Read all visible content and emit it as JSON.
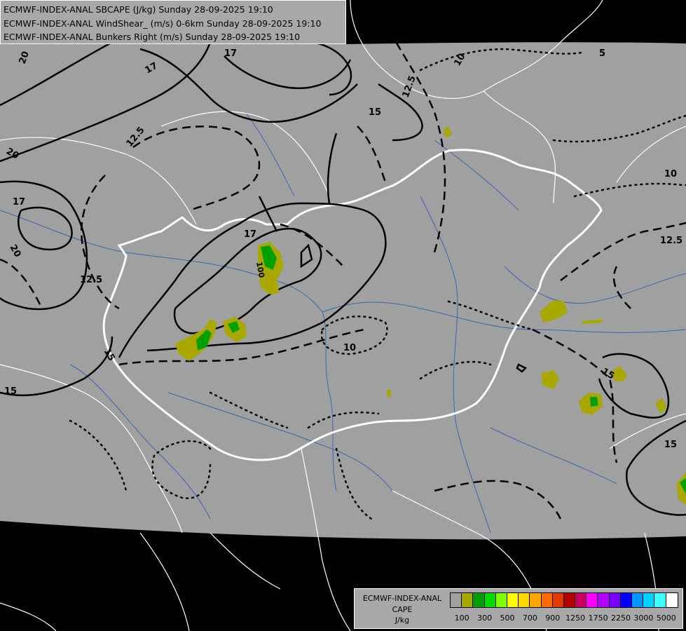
{
  "header": {
    "lines": [
      "ECMWF-INDEX-ANAL SBCAPE (J/kg) Sunday 28-09-2025 19:10",
      "ECMWF-INDEX-ANAL WindShear_ (m/s) 0-6km Sunday 28-09-2025 19:10",
      "ECMWF-INDEX-ANAL Bunkers Right (m/s) Sunday 28-09-2025 19:10"
    ]
  },
  "legend": {
    "title_lines": [
      "ECMWF-INDEX-ANAL",
      "CAPE",
      "J/kg"
    ],
    "colors": [
      "#a0a0a0",
      "#a8a800",
      "#00a000",
      "#00dc00",
      "#80ff00",
      "#ffff00",
      "#ffd700",
      "#ffa500",
      "#ff6a00",
      "#e03c00",
      "#b40000",
      "#c80064",
      "#ff00ff",
      "#b400ff",
      "#7800ff",
      "#0000ff",
      "#0096ff",
      "#00d2ff",
      "#40ffff",
      "#ffffff"
    ],
    "ticks": [
      "100",
      "300",
      "500",
      "700",
      "900",
      "1250",
      "1750",
      "2250",
      "3000",
      "5000"
    ]
  },
  "contour_labels": {
    "ws_20a": "20",
    "ws_17a": "17",
    "ws_17b": "17",
    "ws_15a": "15",
    "ws_20b": "20",
    "ws_17c": "17",
    "ws_20c": "20",
    "ws_15b": "15",
    "ws_17d": "17",
    "ws_15c": "15",
    "ws_15d": "15",
    "ws_15e": "15",
    "br_125a": "12.5",
    "br_125b": "12.5",
    "br_10a": "10",
    "br_125c": "12.5",
    "br_125d": "12.5",
    "br_10b": "10",
    "br_5": "5",
    "br_10c": "10",
    "cape_100": "100"
  }
}
